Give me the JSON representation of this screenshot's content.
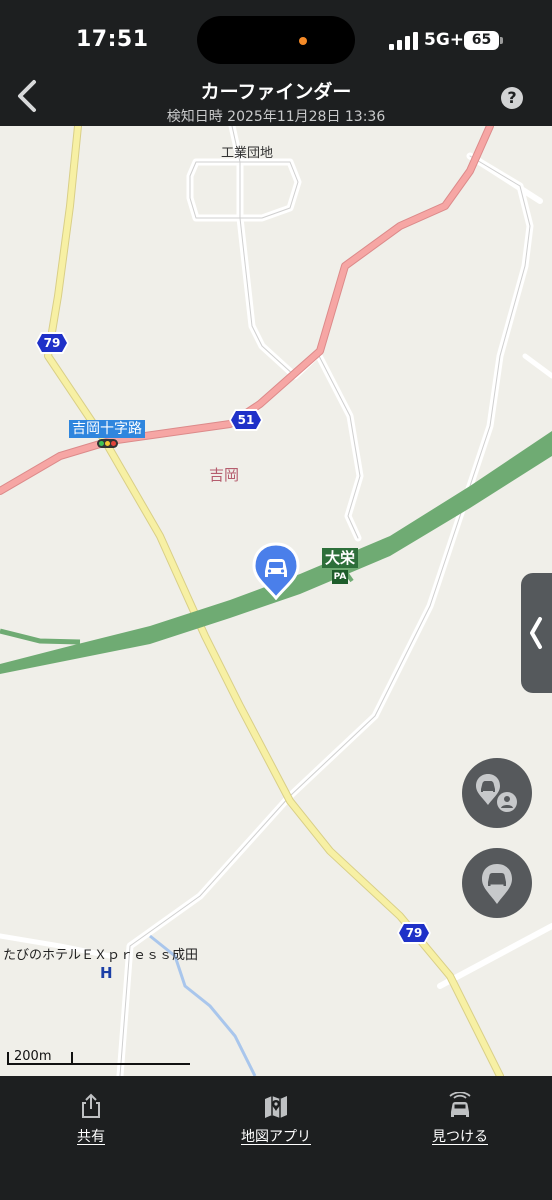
{
  "status_bar": {
    "time": "17:51",
    "network": "5G+",
    "battery": "65"
  },
  "header": {
    "title": "カーファインダー",
    "subtitle": "検知日時 2025年11月28日 13:36",
    "back_icon": "chevron-left-icon",
    "help_label": "?"
  },
  "map": {
    "labels": {
      "industrial": "工業団地",
      "yoshioka": "吉岡",
      "intersection": "吉岡十字路",
      "hotel": "たびのホテルＥＸｐｒｅｓｓ成田",
      "hotel_marker": "H",
      "parking_area": "大栄",
      "parking_icon": "PA"
    },
    "route_shields": {
      "route_79_top": "79",
      "route_51": "51",
      "route_79_bottom": "79"
    },
    "scale": "200m",
    "colors": {
      "map_background": "#f0efe9",
      "expressway": "#6fab73",
      "national_road": "#f6a6a4",
      "prefectural_road": "#f7f0a4",
      "route_shield": "#1f31c8",
      "car_pin": "#4a7fea",
      "water": "#a9c6ec"
    }
  },
  "bottom_nav": {
    "share": "共有",
    "map_app": "地図アプリ",
    "find": "見つける"
  }
}
